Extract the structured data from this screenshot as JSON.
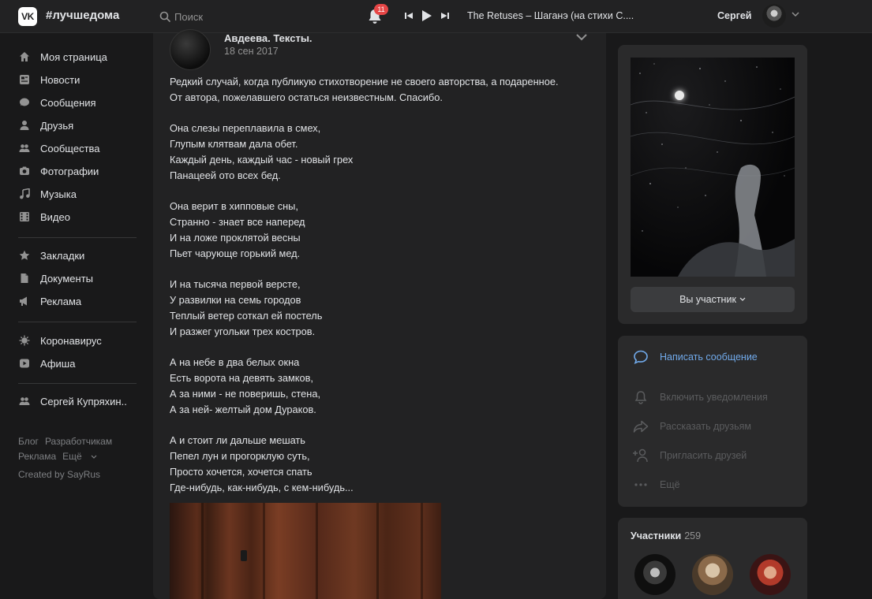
{
  "header": {
    "logo_text": "VK",
    "brand": "#лучшедома",
    "search_placeholder": "Поиск",
    "notifications_count": "11",
    "track_title": "The Retuses – Шаганэ (на стихи С....",
    "user_name": "Сергей"
  },
  "nav": {
    "items": [
      {
        "label": "Моя страница",
        "icon": "home-icon"
      },
      {
        "label": "Новости",
        "icon": "news-icon"
      },
      {
        "label": "Сообщения",
        "icon": "messages-icon"
      },
      {
        "label": "Друзья",
        "icon": "friends-icon"
      },
      {
        "label": "Сообщества",
        "icon": "communities-icon"
      },
      {
        "label": "Фотографии",
        "icon": "camera-icon"
      },
      {
        "label": "Музыка",
        "icon": "music-icon"
      },
      {
        "label": "Видео",
        "icon": "video-icon"
      }
    ],
    "items2": [
      {
        "label": "Закладки",
        "icon": "star-icon"
      },
      {
        "label": "Документы",
        "icon": "document-icon"
      },
      {
        "label": "Реклама",
        "icon": "megaphone-icon"
      }
    ],
    "items3": [
      {
        "label": "Коронавирус",
        "icon": "virus-icon"
      },
      {
        "label": "Афиша",
        "icon": "afisha-icon"
      }
    ],
    "items4": [
      {
        "label": "Сергей Купряхин..",
        "icon": "group-icon"
      }
    ],
    "footer": {
      "blog": "Блог",
      "developers": "Разработчикам",
      "ads": "Реклама",
      "more": "Ещё",
      "credit": "Created by SayRus"
    }
  },
  "post": {
    "author": "Авдеева. Тексты.",
    "date": "18 сен 2017",
    "text": "Редкий случай, когда публикую стихотворение не своего авторства, а подаренное.\nОт автора, пожелавшего остаться неизвестным. Спасибо.\n\nОна слезы переплавила в смех,\nГлупым клятвам дала обет.\nКаждый день, каждый час - новый грех\nПанацеей ото всех бед.\n\nОна верит в хипповые сны,\nСтранно - знает все наперед\nИ на ложе проклятой весны\nПьет чарующе горький мед.\n\nИ на тысяча первой версте,\nУ развилки на семь городов\nТеплый ветер соткал ей постель\nИ разжег угольки трех костров.\n\nА на небе в два белых окна\nЕсть ворота на девять замков,\nА за ними - не поверишь, стена,\nА за ней- желтый дом Дураков.\n\nА и стоит ли дальше мешать\nПепел лун и прогорклую суть,\nПросто хочется, хочется спать\nГде-нибудь, как-нибудь, с кем-нибудь..."
  },
  "sidebar": {
    "join_label": "Вы участник",
    "actions": {
      "message": "Написать сообщение",
      "notify": "Включить уведомления",
      "share": "Рассказать друзьям",
      "invite": "Пригласить друзей",
      "more": "Ещё"
    },
    "members_label": "Участники",
    "members_count": "259"
  },
  "colors": {
    "accent": "#71aaeb",
    "muted_action": "#5b5c5e",
    "background": "#19191a",
    "card": "#2a2a2b"
  }
}
